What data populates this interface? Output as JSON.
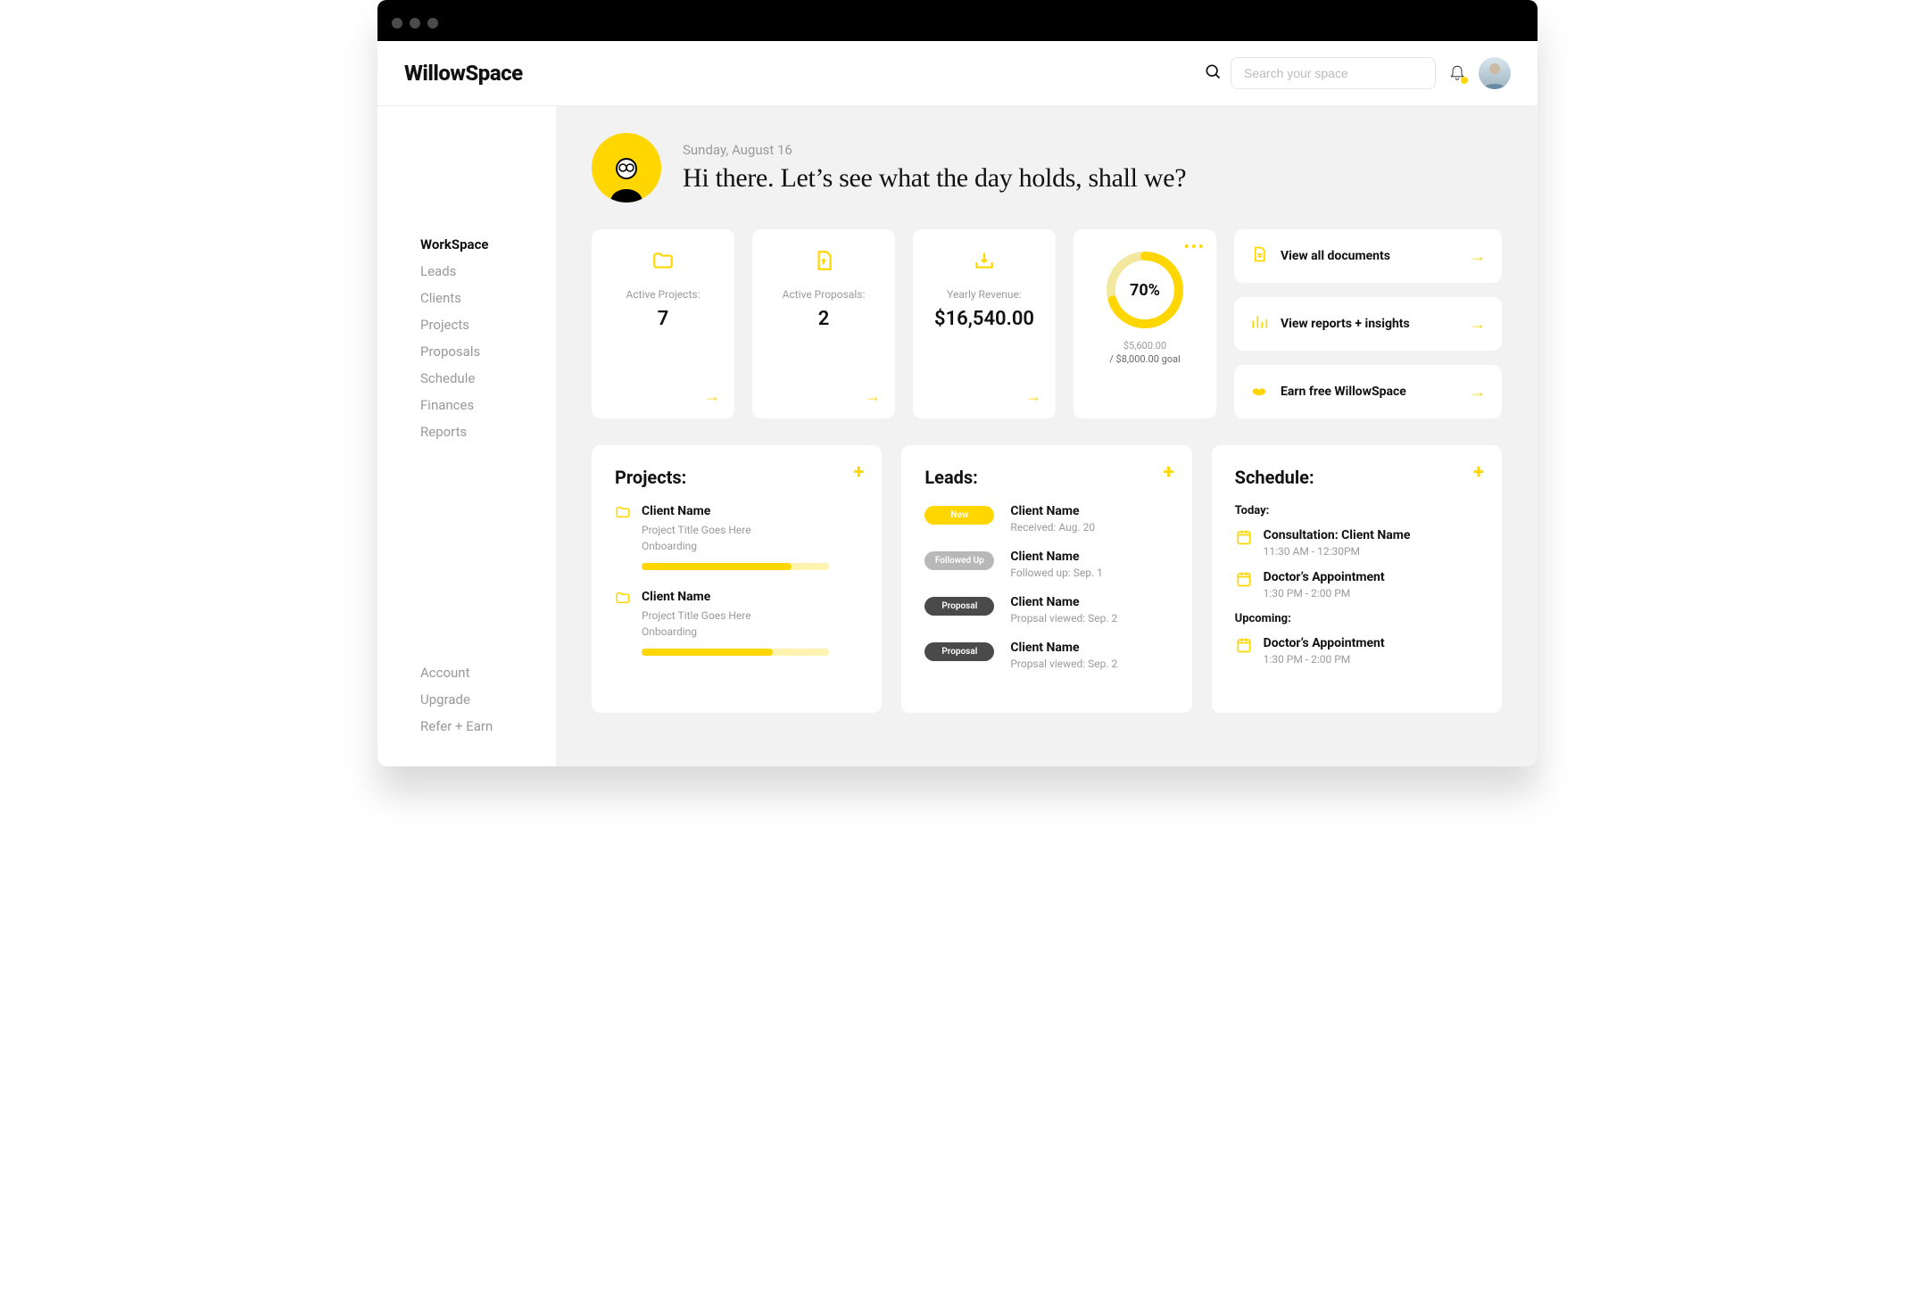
{
  "brand": "WillowSpace",
  "search": {
    "placeholder": "Search your space"
  },
  "nav": {
    "main": [
      "WorkSpace",
      "Leads",
      "Clients",
      "Projects",
      "Proposals",
      "Schedule",
      "Finances",
      "Reports"
    ],
    "bottom": [
      "Account",
      "Upgrade",
      "Refer + Earn"
    ],
    "active_index": 0
  },
  "greeting": {
    "date": "Sunday, August 16",
    "hello": "Hi there. Let’s see what the day holds, shall we?"
  },
  "stats": {
    "active_projects": {
      "label": "Active Projects:",
      "value": "7"
    },
    "active_proposals": {
      "label": "Active Proposals:",
      "value": "2"
    },
    "yearly_revenue": {
      "label": "Yearly Revenue:",
      "value": "$16,540.00"
    }
  },
  "goal": {
    "percent_label": "70%",
    "percent_value": 70,
    "current": "$5,600.00",
    "target": "/ $8,000.00 goal"
  },
  "quicklinks": {
    "documents": "View all documents",
    "reports": "View reports + insights",
    "earn": "Earn free WillowSpace"
  },
  "projects": {
    "title": "Projects:",
    "items": [
      {
        "client": "Client Name",
        "title": "Project Title Goes Here",
        "stage": "Onboarding",
        "progress": 80
      },
      {
        "client": "Client Name",
        "title": "Project Title Goes Here",
        "stage": "Onboarding",
        "progress": 70
      }
    ]
  },
  "leads": {
    "title": "Leads:",
    "items": [
      {
        "badge": "New",
        "badge_class": "new",
        "name": "Client Name",
        "sub": "Received: Aug. 20"
      },
      {
        "badge": "Followed Up",
        "badge_class": "follow",
        "name": "Client Name",
        "sub": "Followed up: Sep. 1"
      },
      {
        "badge": "Proposal",
        "badge_class": "proposal",
        "name": "Client Name",
        "sub": "Propsal viewed: Sep. 2"
      },
      {
        "badge": "Proposal",
        "badge_class": "proposal",
        "name": "Client Name",
        "sub": "Propsal viewed: Sep. 2"
      }
    ]
  },
  "schedule": {
    "title": "Schedule:",
    "today_label": "Today:",
    "upcoming_label": "Upcoming:",
    "today": [
      {
        "name": "Consultation: Client Name",
        "time": "11:30 AM - 12:30PM"
      },
      {
        "name": "Doctor’s Appointment",
        "time": "1:30 PM - 2:00 PM"
      }
    ],
    "upcoming": [
      {
        "name": "Doctor’s Appointment",
        "time": "1:30 PM - 2:00 PM"
      }
    ]
  }
}
